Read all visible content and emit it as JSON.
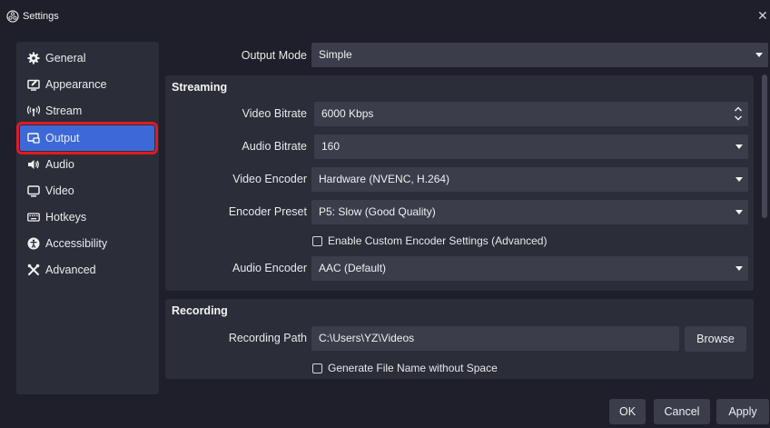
{
  "window": {
    "title": "Settings",
    "close_glyph": "✕"
  },
  "sidebar": {
    "items": [
      {
        "label": "General",
        "icon": "gear-icon"
      },
      {
        "label": "Appearance",
        "icon": "appearance-icon"
      },
      {
        "label": "Stream",
        "icon": "stream-icon"
      },
      {
        "label": "Output",
        "icon": "output-icon",
        "selected": true
      },
      {
        "label": "Audio",
        "icon": "speaker-icon"
      },
      {
        "label": "Video",
        "icon": "monitor-icon"
      },
      {
        "label": "Hotkeys",
        "icon": "keyboard-icon"
      },
      {
        "label": "Accessibility",
        "icon": "accessibility-icon"
      },
      {
        "label": "Advanced",
        "icon": "tools-icon"
      }
    ]
  },
  "output_mode": {
    "label": "Output Mode",
    "value": "Simple"
  },
  "streaming": {
    "title": "Streaming",
    "video_bitrate": {
      "label": "Video Bitrate",
      "value": "6000 Kbps"
    },
    "audio_bitrate": {
      "label": "Audio Bitrate",
      "value": "160"
    },
    "video_encoder": {
      "label": "Video Encoder",
      "value": "Hardware (NVENC, H.264)"
    },
    "encoder_preset": {
      "label": "Encoder Preset",
      "value": "P5: Slow (Good Quality)"
    },
    "custom_encoder_settings": {
      "label": "Enable Custom Encoder Settings (Advanced)",
      "checked": false
    },
    "audio_encoder": {
      "label": "Audio Encoder",
      "value": "AAC (Default)"
    }
  },
  "recording": {
    "title": "Recording",
    "path": {
      "label": "Recording Path",
      "value": "C:\\Users\\YZ\\Videos"
    },
    "browse_label": "Browse",
    "no_space_filename": {
      "label": "Generate File Name without Space",
      "checked": false
    }
  },
  "footer": {
    "ok_label": "OK",
    "cancel_label": "Cancel",
    "apply_label": "Apply"
  },
  "colors": {
    "accent": "#3d69d8",
    "highlight_border": "#e11a21",
    "background": "#1e1f2a",
    "panel": "#2b2d39",
    "field": "#3b3d4b"
  }
}
